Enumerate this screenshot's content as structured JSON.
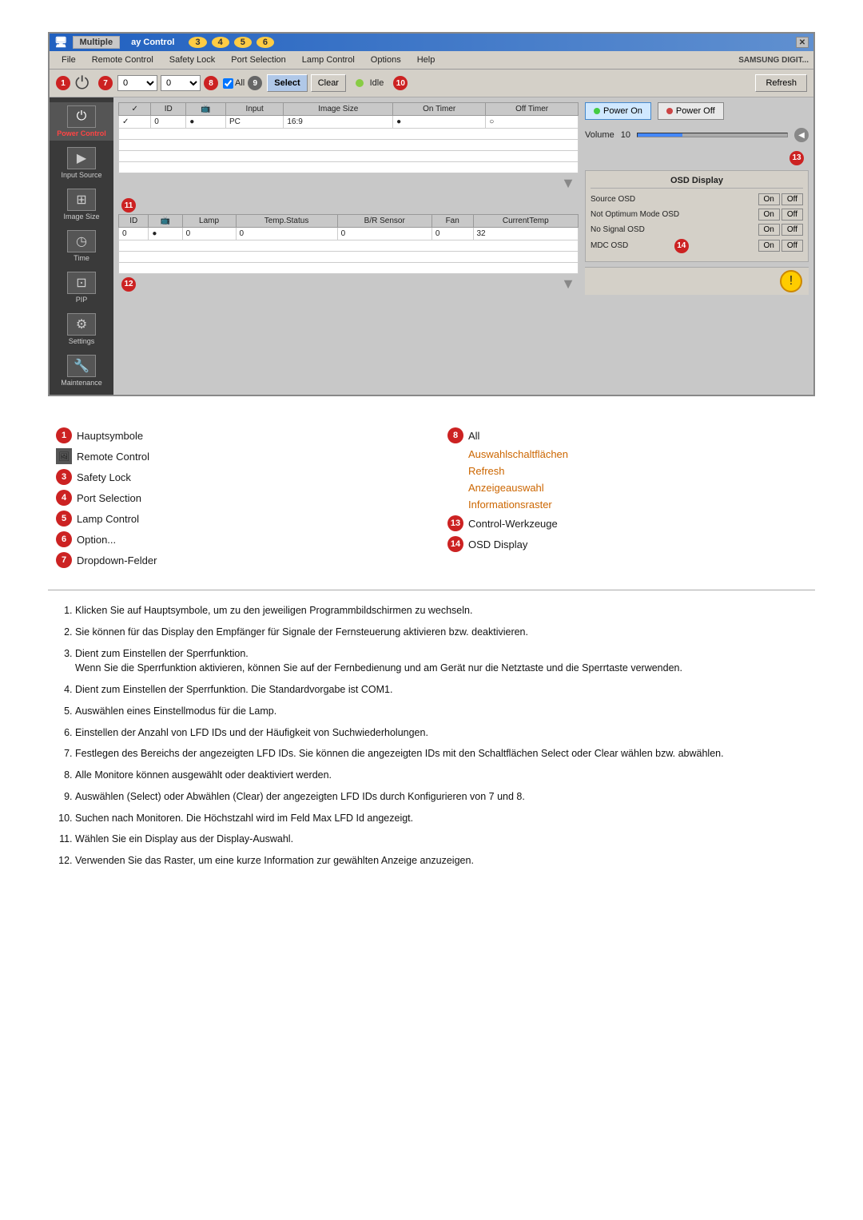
{
  "window": {
    "title": "Multiple Display Control",
    "close_label": "X",
    "tabs": [
      "Multiple",
      "ay Contro",
      "3",
      "4",
      "5",
      "6"
    ]
  },
  "menu": {
    "items": [
      "File",
      "Remote Control",
      "Safety Lock",
      "Port Selection",
      "Lamp Control",
      "Options",
      "Help"
    ],
    "brand": "SAMSUNG DIGIT..."
  },
  "toolbar": {
    "select_label": "Select",
    "clear_label": "Clear",
    "refresh_label": "Refresh",
    "all_label": "All",
    "idle_label": "Idle",
    "dropdown1_val": "0",
    "dropdown2_val": "0"
  },
  "sidebar": {
    "items": [
      {
        "id": "power-control",
        "label": "Power Control",
        "icon": "⏻"
      },
      {
        "id": "input-source",
        "label": "Input Source",
        "icon": "▶"
      },
      {
        "id": "image-size",
        "label": "Image Size",
        "icon": "⊞"
      },
      {
        "id": "time",
        "label": "Time",
        "icon": "◷"
      },
      {
        "id": "pip",
        "label": "PIP",
        "icon": "⊡"
      },
      {
        "id": "settings",
        "label": "Settings",
        "icon": "⚙"
      },
      {
        "id": "maintenance",
        "label": "Maintenance",
        "icon": "🔧"
      }
    ]
  },
  "grid": {
    "top_headers": [
      "✓",
      "ID",
      "📺",
      "Input",
      "Image Size",
      "On Timer",
      "Off Timer"
    ],
    "top_row": [
      "✓",
      "0",
      "●",
      "PC",
      "16:9",
      "●",
      "○"
    ],
    "bottom_headers": [
      "ID",
      "📺",
      "Lamp",
      "Temp.Status",
      "B/R Sensor",
      "Fan",
      "CurrentTemp"
    ],
    "bottom_row": [
      "0",
      "●",
      "0",
      "0",
      "0",
      "0",
      "32"
    ]
  },
  "controls": {
    "power_on_label": "Power On",
    "power_off_label": "Power Off",
    "volume_label": "Volume",
    "volume_value": "10",
    "osd": {
      "title": "OSD Display",
      "rows": [
        {
          "label": "Source OSD",
          "on": "On",
          "off": "Off"
        },
        {
          "label": "Not Optimum Mode OSD",
          "on": "On",
          "off": "Off"
        },
        {
          "label": "No Signal OSD",
          "on": "On",
          "off": "Off"
        },
        {
          "label": "MDC OSD",
          "on": "On",
          "off": "Off"
        }
      ]
    }
  },
  "legend": {
    "left": [
      {
        "num": "1",
        "type": "red",
        "label": "Hauptsymbole"
      },
      {
        "num": "2",
        "type": "img",
        "label": "Remote Control"
      },
      {
        "num": "3",
        "type": "red",
        "label": "Safety Lock"
      },
      {
        "num": "4",
        "type": "red",
        "label": "Port Selection"
      },
      {
        "num": "5",
        "type": "red",
        "label": "Lamp Control"
      },
      {
        "num": "6",
        "type": "red",
        "label": "Option..."
      },
      {
        "num": "7",
        "type": "red",
        "label": "Dropdown-Felder"
      }
    ],
    "right": [
      {
        "num": "8",
        "type": "red",
        "label": "All"
      },
      {
        "num": "",
        "type": "none",
        "label": "Auswahlschaltflächen"
      },
      {
        "num": "",
        "type": "none",
        "label": "Refresh"
      },
      {
        "num": "",
        "type": "none",
        "label": "Anzeigeauswahl"
      },
      {
        "num": "",
        "type": "none",
        "label": "Informationsraster"
      },
      {
        "num": "13",
        "type": "red",
        "label": "Control-Werkzeuge"
      },
      {
        "num": "14",
        "type": "red",
        "label": "OSD Display"
      }
    ]
  },
  "descriptions": [
    "Klicken Sie auf Hauptsymbole, um zu den jeweiligen Programmbildschirmen zu wechseln.",
    "Sie können für das Display den Empfänger für Signale der Fernsteuerung aktivieren bzw. deaktivieren.",
    "Dient zum Einstellen der Sperrfunktion.\nWenn Sie die Sperrfunktion aktivieren, können Sie auf der Fernbedienung und am Gerät nur die Netztaste und die Sperrtaste verwenden.",
    "Dient zum Einstellen der Sperrfunktion. Die Standardvorgabe ist COM1.",
    "Auswählen eines Einstellmodus für die Lamp.",
    "Einstellen der Anzahl von LFD IDs und der Häufigkeit von Suchwiederholungen.",
    "Festlegen des Bereichs der angezeigten LFD IDs. Sie können die angezeigten IDs mit den Schaltflächen Select oder Clear wählen bzw. abwählen.",
    "Alle Monitore können ausgewählt oder deaktiviert werden.",
    "Auswählen (Select) oder Abwählen (Clear) der angezeigten LFD IDs durch Konfigurieren von 7 und 8.",
    "Suchen nach Monitoren. Die Höchstzahl wird im Feld Max LFD Id angezeigt.",
    "Wählen Sie ein Display aus der Display-Auswahl.",
    "Verwenden Sie das Raster, um eine kurze Information zur gewählten Anzeige anzuzeigen."
  ]
}
